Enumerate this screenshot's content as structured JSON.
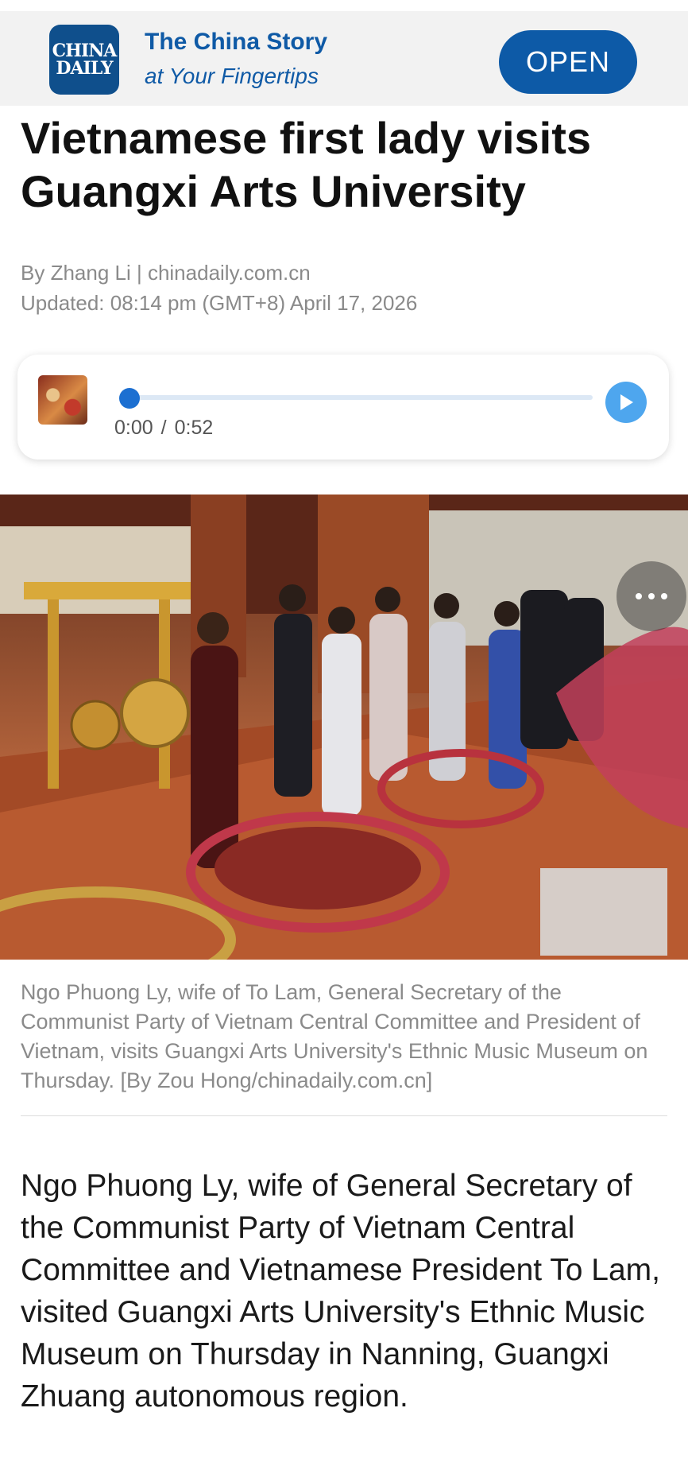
{
  "banner": {
    "logo_line1": "CHINA",
    "logo_line2": "DAILY",
    "title": "The China Story",
    "subtitle": "at Your Fingertips",
    "open_label": "OPEN",
    "brand_color": "#0f4f8c"
  },
  "article": {
    "headline": "Vietnamese first lady visits Guangxi Arts University",
    "byline": "By Zhang Li | chinadaily.com.cn",
    "updated": "Updated: 08:14 pm (GMT+8) April 17, 2026",
    "caption": "Ngo Phuong Ly, wife of To Lam, General Secretary of the Communist Party of Vietnam Central Committee and President of Vietnam, visits Guangxi Arts University's Ethnic Music Museum on Thursday. [By Zou Hong/chinadaily.com.cn]",
    "body": "Ngo Phuong Ly, wife of General Secretary of the Communist Party of Vietnam Central Committee and Vietnamese President To Lam, visited Guangxi Arts University's Ethnic Music Museum on Thursday in Nanning, Guangxi Zhuang autonomous region."
  },
  "audio": {
    "current_time": "0:00",
    "separator": "/",
    "duration": "0:52",
    "progress": 0,
    "play_icon": "play-icon",
    "accent_color": "#1c6fd1"
  },
  "photo": {
    "more_icon": "more-dots-icon"
  }
}
